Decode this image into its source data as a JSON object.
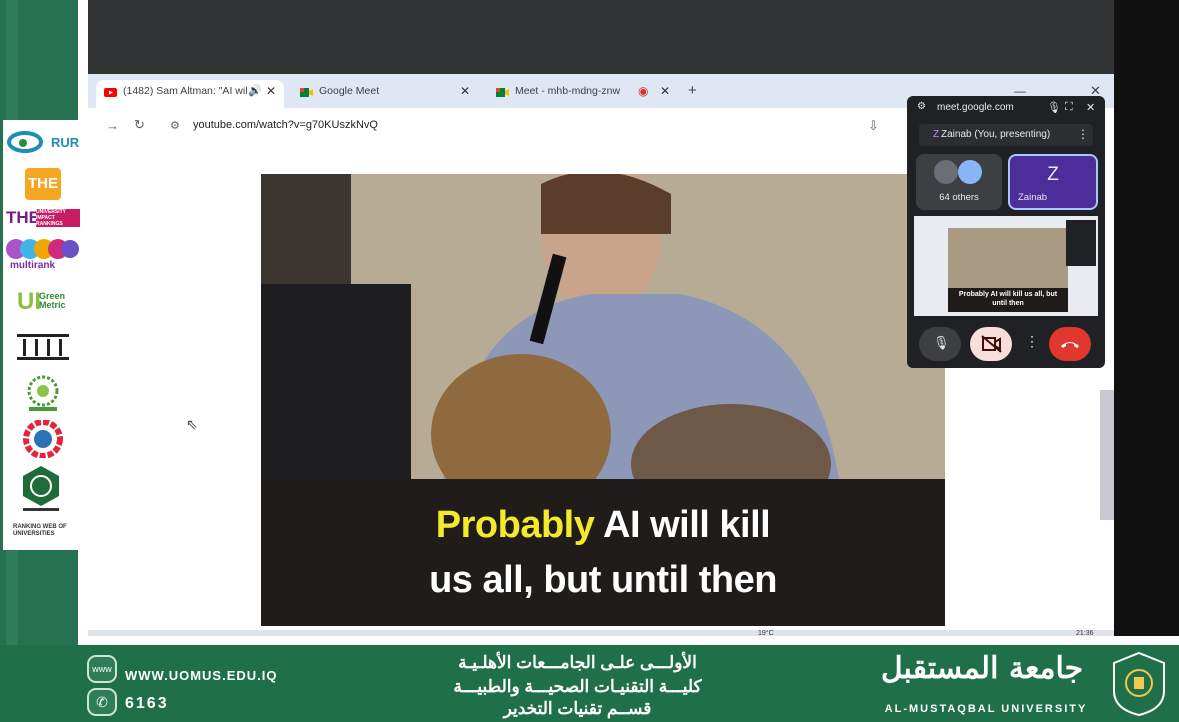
{
  "browser": {
    "tabs": [
      {
        "label": "(1482) Sam Altman: \"AI wil",
        "active": true
      },
      {
        "label": "Google Meet",
        "active": false
      },
      {
        "label": "Meet - mhb-mdng-znw",
        "active": false
      }
    ],
    "new_tab_label": "+",
    "url": "youtube.com/watch?v=g70KUszkNvQ"
  },
  "video": {
    "caption_line1_highlight": "Probably",
    "caption_line1_rest": " AI will kill",
    "caption_line2": "us all, but until then"
  },
  "meet_popup": {
    "url": "meet.google.com",
    "presenter_initial": "Z",
    "presenter_label": "Zainab (You, presenting)",
    "others_label": "64 others",
    "tile_initial": "Z",
    "tile_name": "Zainab",
    "preview_caption": "Probably AI will kill us all, but until then"
  },
  "logos": {
    "rur": "RUR",
    "the": "THE",
    "the_impact": "UNIVERSITY IMPACT RANKINGS",
    "multirank": "multirank",
    "greenmetric": "Green Metric",
    "webometrics": "RANKING WEB OF UNIVERSITIES"
  },
  "footer": {
    "website": "WWW.UOMUS.EDU.IQ",
    "phone": "6163",
    "arabic_line1": "الأولـــى علـى الجامـــعات الأهلـيـة",
    "arabic_line2": "كليـــة التقنيـات الصحيـــة والطبيـــة",
    "arabic_line3": "قســم تقنيات التخدير",
    "uni_arabic": "جامعة المستقبل",
    "uni_english": "AL-MUSTAQBAL UNIVERSITY"
  },
  "taskbar": {
    "temp": "19°C",
    "time": "21:36"
  },
  "colors": {
    "frame_green": "#26714f",
    "caption_yellow": "#f2ea2b",
    "end_call": "#e0372e"
  }
}
